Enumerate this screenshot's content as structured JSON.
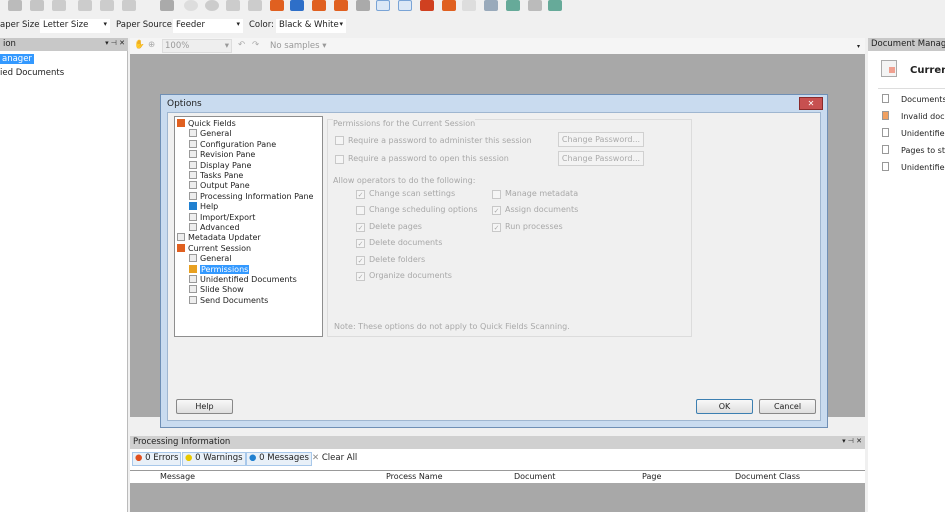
{
  "toolbar2": {
    "paper_size_label": "aper Size:",
    "paper_size": "Letter Size",
    "paper_source_label": "Paper Source:",
    "paper_source": "Feeder",
    "color_label": "Color:",
    "color": "Black & White"
  },
  "left_panel": {
    "title": "ion",
    "items": [
      "anager",
      "ied Documents"
    ]
  },
  "viewer": {
    "zoom": "100%",
    "samples": "No samples"
  },
  "right_panel": {
    "title": "Document Manage",
    "heading": "Curren",
    "items": [
      "Documents",
      "Invalid docu",
      "Unidentified",
      "Pages to sto",
      "Unidentified"
    ]
  },
  "dialog": {
    "title": "Options",
    "tree": [
      {
        "label": "Quick Fields",
        "level": 0
      },
      {
        "label": "General",
        "level": 1
      },
      {
        "label": "Configuration Pane",
        "level": 1
      },
      {
        "label": "Revision Pane",
        "level": 1
      },
      {
        "label": "Display Pane",
        "level": 1
      },
      {
        "label": "Tasks Pane",
        "level": 1
      },
      {
        "label": "Output Pane",
        "level": 1
      },
      {
        "label": "Processing Information Pane",
        "level": 1
      },
      {
        "label": "Help",
        "level": 1
      },
      {
        "label": "Import/Export",
        "level": 1
      },
      {
        "label": "Advanced",
        "level": 1
      },
      {
        "label": "Metadata Updater",
        "level": 0
      },
      {
        "label": "Current Session",
        "level": 0
      },
      {
        "label": "General",
        "level": 1
      },
      {
        "label": "Permissions",
        "level": 1,
        "selected": true
      },
      {
        "label": "Unidentified Documents",
        "level": 1
      },
      {
        "label": "Slide Show",
        "level": 1
      },
      {
        "label": "Send Documents",
        "level": 1
      }
    ],
    "group_title": "Permissions for the Current Session",
    "require_admin_pw": "Require a password to administer this session",
    "require_open_pw": "Require a password to open this session",
    "change_password": "Change Password...",
    "allow_label": "Allow operators to do the following:",
    "perms": [
      {
        "label": "Change scan settings",
        "checked": true
      },
      {
        "label": "Change scheduling options",
        "checked": false
      },
      {
        "label": "Delete pages",
        "checked": true
      },
      {
        "label": "Delete documents",
        "checked": true
      },
      {
        "label": "Delete folders",
        "checked": true
      },
      {
        "label": "Organize documents",
        "checked": true
      },
      {
        "label": "Manage metadata",
        "checked": false
      },
      {
        "label": "Assign documents",
        "checked": true
      },
      {
        "label": "Run processes",
        "checked": true
      }
    ],
    "note": "Note: These options do not apply to Quick Fields Scanning.",
    "help": "Help",
    "ok": "OK",
    "cancel": "Cancel"
  },
  "processing": {
    "title": "Processing Information",
    "errors": "0 Errors",
    "warnings": "0 Warnings",
    "messages": "0 Messages",
    "clear": "Clear All",
    "columns": [
      "Message",
      "Process Name",
      "Document",
      "Page",
      "Document Class"
    ]
  }
}
